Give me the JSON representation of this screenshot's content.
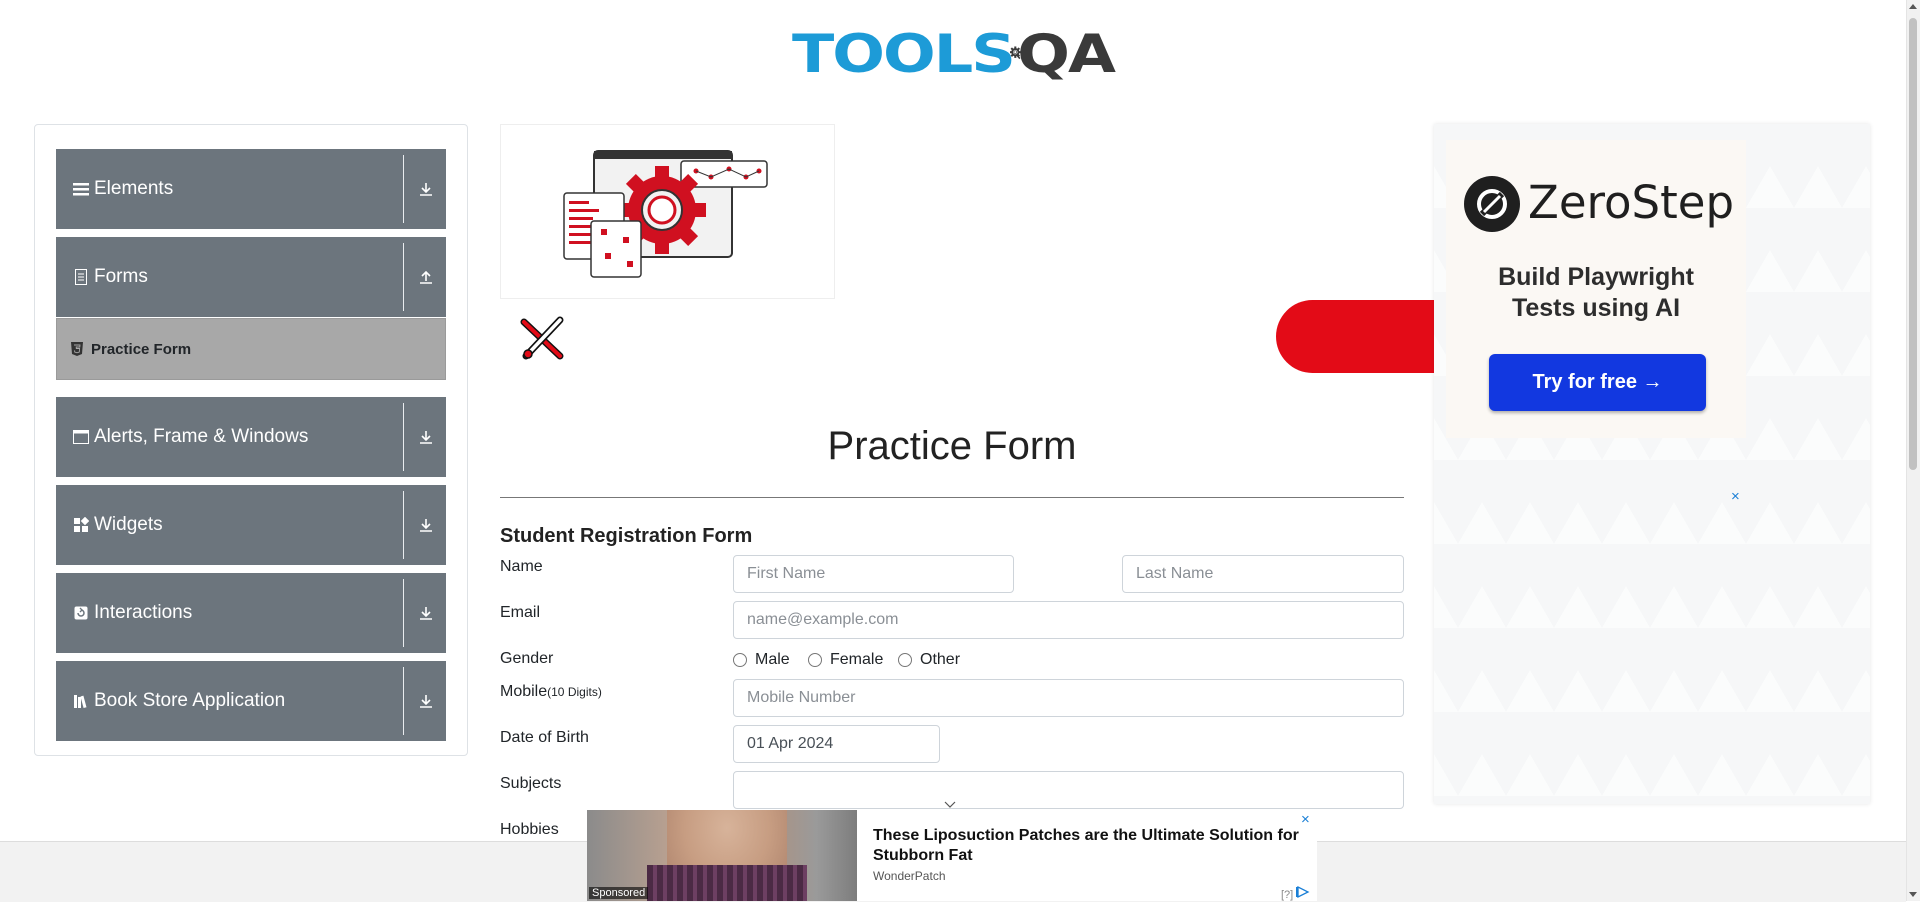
{
  "logo": {
    "tools": "TOOLS",
    "qa": "QA",
    "brand_blue": "#1d9bd7",
    "brand_dark": "#3a3a3a"
  },
  "sidebar": {
    "groups": [
      {
        "label": "Elements",
        "icon": "list-icon",
        "arrow": "download-arrow-icon"
      },
      {
        "label": "Forms",
        "icon": "document-icon",
        "arrow": "upload-arrow-icon"
      },
      {
        "label": "Alerts, Frame & Windows",
        "icon": "window-icon",
        "arrow": "download-arrow-icon"
      },
      {
        "label": "Widgets",
        "icon": "widgets-icon",
        "arrow": "download-arrow-icon"
      },
      {
        "label": "Interactions",
        "icon": "interaction-icon",
        "arrow": "download-arrow-icon"
      },
      {
        "label": "Book Store Application",
        "icon": "books-icon",
        "arrow": "download-arrow-icon"
      }
    ],
    "active_item": {
      "label": "Practice Form",
      "icon": "html5-icon"
    },
    "group_color": "#6c757d",
    "active_color": "#a8a8a8"
  },
  "main": {
    "title": "Practice Form",
    "form_title": "Student Registration Form",
    "name": {
      "label": "Name",
      "first_placeholder": "First Name",
      "last_placeholder": "Last Name"
    },
    "email": {
      "label": "Email",
      "placeholder": "name@example.com"
    },
    "gender": {
      "label": "Gender",
      "options": [
        "Male",
        "Female",
        "Other"
      ]
    },
    "mobile": {
      "label": "Mobile",
      "hint": "(10 Digits)",
      "placeholder": "Mobile Number"
    },
    "dob": {
      "label": "Date of Birth",
      "value": "01 Apr 2024"
    },
    "subjects": {
      "label": "Subjects",
      "value": ""
    },
    "hobbies": {
      "label": "Hobbies"
    }
  },
  "ad_right": {
    "brand": "ZeroStep",
    "tagline_1": "Build Playwright",
    "tagline_2": "Tests using AI",
    "cta": "Try for free →",
    "close": "×",
    "cta_color": "#1238e0"
  },
  "ad_bottom": {
    "headline": "These Liposuction Patches are the Ultimate Solution for Stubborn Fat",
    "source": "WonderPatch",
    "sponsored": "Sponsored",
    "close": "×",
    "info": "[?]"
  },
  "accent_red": "#e30b17"
}
